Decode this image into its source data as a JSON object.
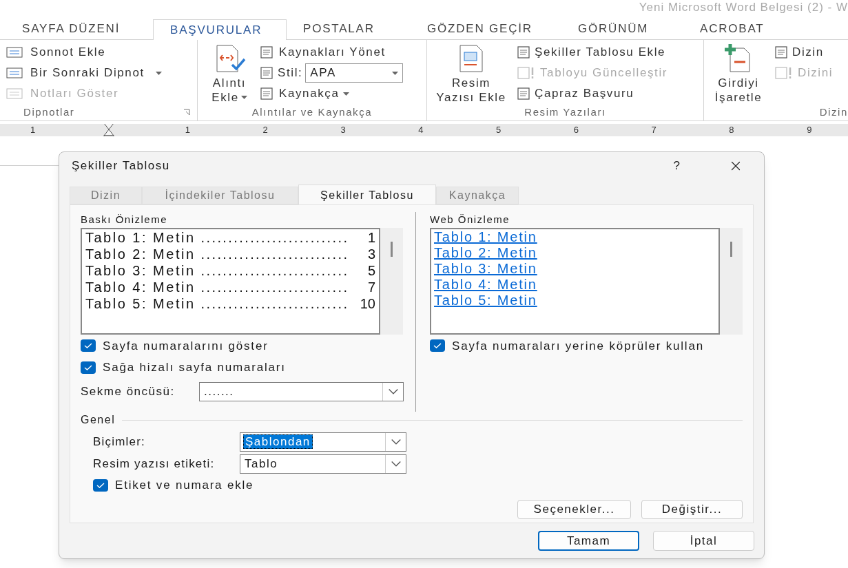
{
  "window": {
    "title": "Yeni Microsoft Word Belgesi (2) - W"
  },
  "ribbon_tabs": [
    {
      "label": "SAYFA DÜZENİ",
      "selected": false
    },
    {
      "label": "BAŞVURULAR",
      "selected": true
    },
    {
      "label": "POSTALAR",
      "selected": false
    },
    {
      "label": "GÖZDEN GEÇİR",
      "selected": false
    },
    {
      "label": "GÖRÜNÜM",
      "selected": false
    },
    {
      "label": "ACROBAT",
      "selected": false
    }
  ],
  "ribbon": {
    "footnotes": {
      "label": "Dipnotlar",
      "items": [
        {
          "label": "Sonnot Ekle",
          "disabled": false
        },
        {
          "label": "Bir Sonraki Dipnot",
          "disabled": false
        },
        {
          "label": "Notları Göster",
          "disabled": true
        }
      ]
    },
    "citations": {
      "label": "Alıntılar ve Kaynakça",
      "insert_button": [
        "Alıntı",
        "Ekle"
      ],
      "manage": "Kaynakları Yönet",
      "style_label": "Stil:",
      "style_value": "APA",
      "bibliography": "Kaynakça"
    },
    "captions": {
      "label": "Resim Yazıları",
      "insert_button": [
        "Resim",
        "Yazısı Ekle"
      ],
      "items": [
        {
          "label": "Şekiller Tablosu Ekle",
          "disabled": false
        },
        {
          "label": "Tabloyu Güncelleştir",
          "disabled": true
        },
        {
          "label": "Çapraz Başvuru",
          "disabled": false
        }
      ]
    },
    "index": {
      "label": "Dizin",
      "mark_button": [
        "Girdiyi",
        "İşaretle"
      ],
      "items": [
        {
          "label": "Dizin",
          "disabled": false
        },
        {
          "label": "Dizini",
          "disabled": true
        }
      ]
    }
  },
  "ruler": [
    "1",
    "1",
    "2",
    "3",
    "4",
    "5",
    "6",
    "7",
    "8",
    "9"
  ],
  "dialog": {
    "title": "Şekiller Tablosu",
    "help": "?",
    "tabs": [
      {
        "label": "Dizin",
        "selected": false
      },
      {
        "label": "İçindekiler Tablosu",
        "selected": false
      },
      {
        "label": "Şekiller Tablosu",
        "selected": true
      },
      {
        "label": "Kaynakça",
        "selected": false
      }
    ],
    "print_preview": {
      "label": "Baskı Önizleme",
      "lines": [
        {
          "text": "Tablo 1: Metin",
          "leader": "...........................",
          "page": "1"
        },
        {
          "text": "Tablo 2: Metin",
          "leader": "...........................",
          "page": "3"
        },
        {
          "text": "Tablo 3: Metin",
          "leader": "...........................",
          "page": "5"
        },
        {
          "text": "Tablo 4: Metin",
          "leader": "...........................",
          "page": "7"
        },
        {
          "text": "Tablo 5: Metin",
          "leader": "...........................",
          "page": "10"
        }
      ]
    },
    "print_options": [
      {
        "label": "Sayfa numaralarını göster",
        "checked": true
      },
      {
        "label": "Sağa hizalı sayfa numaraları",
        "checked": true
      }
    ],
    "tab_leader": {
      "label": "Sekme öncüsü:",
      "value": "......."
    },
    "web_preview": {
      "label": "Web Önizleme",
      "links": [
        "Tablo 1: Metin",
        "Tablo 2: Metin",
        "Tablo 3: Metin",
        "Tablo 4: Metin",
        "Tablo 5: Metin"
      ]
    },
    "web_options": [
      {
        "label": "Sayfa numaraları yerine köprüler kullan",
        "checked": true
      }
    ],
    "general": {
      "label": "Genel",
      "formats": {
        "label": "Biçimler:",
        "value": "Şablondan"
      },
      "caption_label": {
        "label": "Resim yazısı etiketi:",
        "value": "Tablo"
      },
      "options": [
        {
          "label": "Etiket ve numara ekle",
          "checked": true
        }
      ]
    },
    "panel_buttons": [
      "Seçenekler...",
      "Değiştir..."
    ],
    "buttons": [
      {
        "label": "Tamam",
        "default": true
      },
      {
        "label": "İptal",
        "default": false
      }
    ]
  }
}
